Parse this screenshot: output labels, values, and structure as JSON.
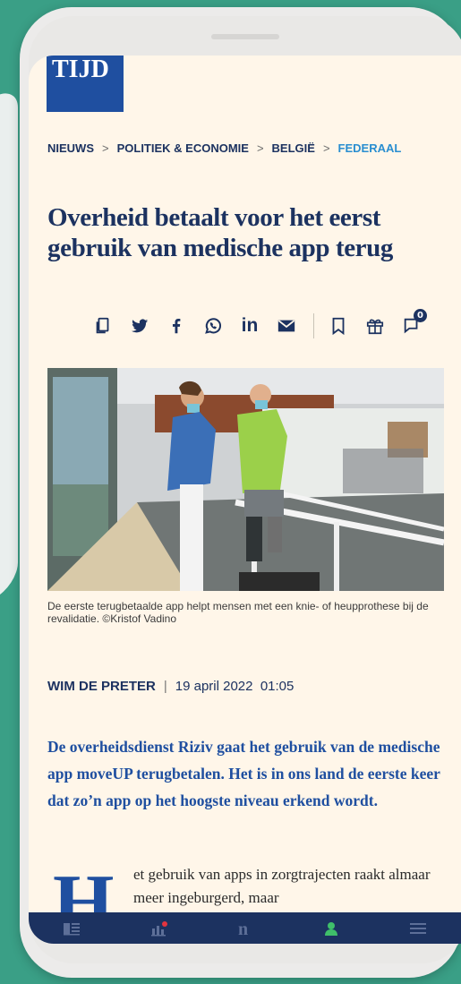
{
  "logo": {
    "text": "TIJD"
  },
  "breadcrumb": {
    "items": [
      "NIEUWS",
      "POLITIEK & ECONOMIE",
      "BELGIË",
      "FEDERAAL"
    ],
    "separator": ">"
  },
  "article": {
    "title": "Overheid betaalt voor het eerst gebruik van medische app terug",
    "caption": "De eerste terugbetaalde app helpt mensen met een knie- of heupprothese bij de revalidatie. ©Kristof Vadino",
    "author": "WIM DE PRETER",
    "date": "19 april 2022",
    "time": "01:05",
    "lead": "De overheidsdienst Riziv gaat het gebruik van de medische app moveUP terugbetalen. Het is in ons land de eerste keer dat zo’n app op het hoogste niveau erkend wordt.",
    "dropcap": "H",
    "body_start": "et gebruik van apps in zorgtrajecten raakt almaar meer ingeburgerd, maar"
  },
  "share": {
    "icons": [
      "copy-icon",
      "twitter-icon",
      "facebook-icon",
      "whatsapp-icon",
      "linkedin-icon",
      "mail-icon",
      "bookmark-icon",
      "gift-icon",
      "comment-icon"
    ],
    "comment_count": "0"
  },
  "tabbar": {
    "items": [
      "news-icon",
      "markets-icon",
      "n-logo-icon",
      "account-icon",
      "menu-icon"
    ]
  },
  "colors": {
    "background": "#3a9f86",
    "paper": "#fff6e9",
    "navy": "#1c3260",
    "brand_blue": "#1f4fa0",
    "link_blue": "#2a8ed0"
  }
}
